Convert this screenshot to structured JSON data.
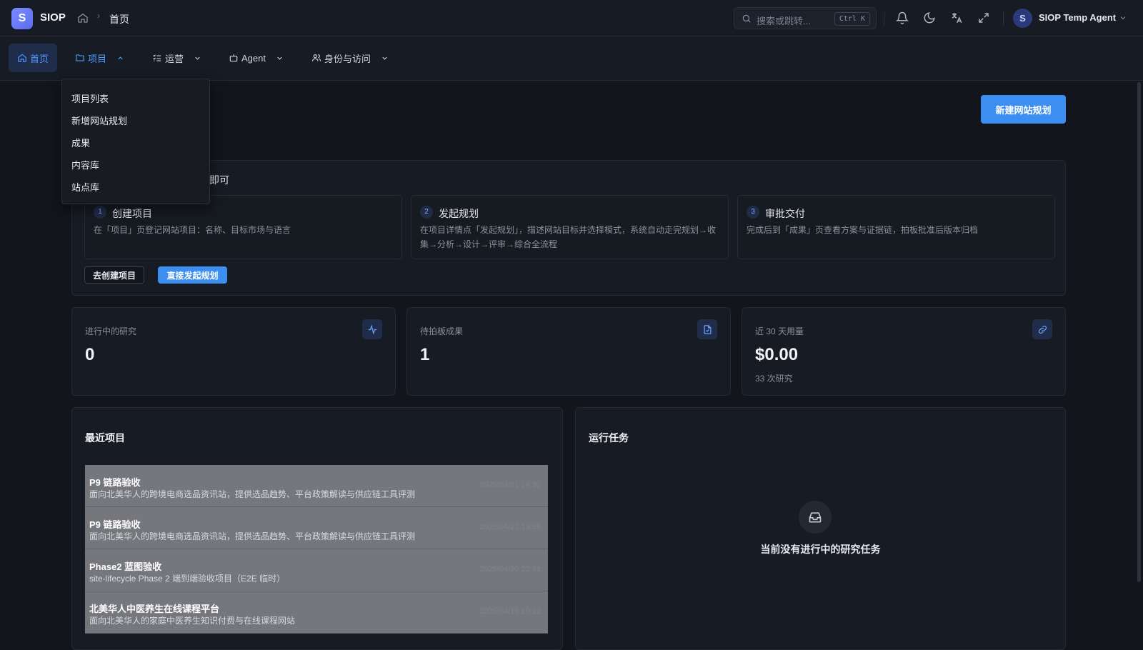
{
  "app": {
    "logo_letter": "S",
    "name": "SIOP"
  },
  "breadcrumb": {
    "current": "首页"
  },
  "search": {
    "placeholder": "搜索或跳转...",
    "shortcut": "Ctrl K"
  },
  "user": {
    "initial": "S",
    "name": "SIOP Temp Agent"
  },
  "nav": {
    "items": [
      {
        "label": "首页",
        "icon": "home-icon"
      },
      {
        "label": "项目",
        "icon": "folder-icon"
      },
      {
        "label": "运营",
        "icon": "list-check-icon"
      },
      {
        "label": "Agent",
        "icon": "bot-icon"
      },
      {
        "label": "身份与访问",
        "icon": "users-icon"
      }
    ]
  },
  "dropdown": {
    "items": [
      "项目列表",
      "新增网站规划",
      "成果",
      "内容库",
      "站点库"
    ]
  },
  "actions": {
    "new_plan": "新建网站规划"
  },
  "guide": {
    "title_visible": "即可",
    "steps": [
      {
        "num": "1",
        "title": "创建项目",
        "desc": "在「项目」页登记网站项目：名称、目标市场与语言"
      },
      {
        "num": "2",
        "title": "发起规划",
        "desc": "在项目详情点「发起规划」，描述网站目标并选择模式，系统自动走完规划→收集→分析→设计→评审→综合全流程"
      },
      {
        "num": "3",
        "title": "审批交付",
        "desc": "完成后到「成果」页查看方案与证据链，拍板批准后版本归档"
      }
    ],
    "btn_create": "去创建项目",
    "btn_plan": "直接发起规划"
  },
  "stats": [
    {
      "label": "进行中的研究",
      "value": "0",
      "sub": "",
      "icon": "activity-icon"
    },
    {
      "label": "待拍板成果",
      "value": "1",
      "sub": "",
      "icon": "file-check-icon"
    },
    {
      "label": "近 30 天用量",
      "value": "$0.00",
      "sub": "33 次研究",
      "icon": "link-icon"
    }
  ],
  "recent": {
    "title": "最近项目",
    "items": [
      {
        "name": "P9 链路验收",
        "desc": "面向北美华人的跨境电商选品资讯站，提供选品趋势、平台政策解读与供应链工具评测",
        "date": "2025/04/21 14:20"
      },
      {
        "name": "P9 链路验收",
        "desc": "面向北美华人的跨境电商选品资讯站，提供选品趋势、平台政策解读与供应链工具评测",
        "date": "2025/04/21 13:58"
      },
      {
        "name": "Phase2 蓝图验收",
        "desc": "site-lifecycle Phase 2 端到端验收项目（E2E 临时）",
        "date": "2025/04/20 22:41"
      },
      {
        "name": "北美华人中医养生在线课程平台",
        "desc": "面向北美华人的家庭中医养生知识付费与在线课程网站",
        "date": "2025/04/19 10:12"
      }
    ]
  },
  "tasks": {
    "title": "运行任务",
    "empty": "当前没有进行中的研究任务"
  }
}
